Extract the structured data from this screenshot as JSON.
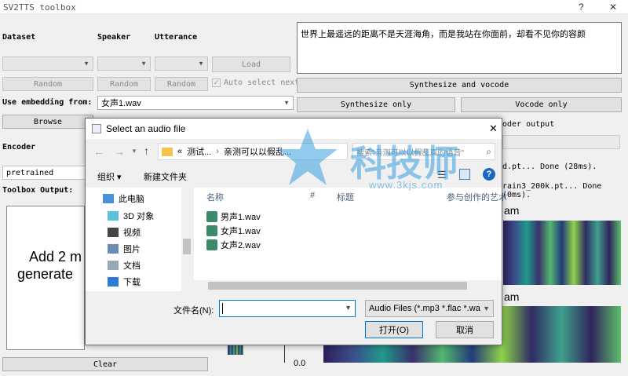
{
  "window": {
    "title": "SV2TTS toolbox",
    "help": "?",
    "close": "✕"
  },
  "main": {
    "dataset_label": "Dataset",
    "speaker_label": "Speaker",
    "utterance_label": "Utterance",
    "load_button": "Load",
    "random1": "Random",
    "random2": "Random",
    "random3": "Random",
    "auto_select": "Auto select next",
    "use_embedding_label": "Use embedding from:",
    "embedding_value": "女声1.wav",
    "browse_button": "Browse",
    "encoder_label": "Encoder",
    "encoder_value": "pretrained",
    "toolbox_output_label": "Toolbox Output:",
    "placeholder_text_1": "Add 2 m",
    "placeholder_text_2": "generate",
    "clear_button": "Clear",
    "text_input": "世界上最遥远的距离不是天涯海角，而是我站在你面前，却看不见你的容颜",
    "synth_vocode_button": "Synthesize and vocode",
    "synth_only_button": "Synthesize only",
    "vocode_only_button": "Vocode only",
    "encoder_output_label": "oder output",
    "log_line1": "d.pt... Done (28ms).",
    "log_line2": "rain3_200k.pt... Done (0ms).",
    "spec_title1": "am",
    "spec_title2": "am",
    "axis_value": "0.0"
  },
  "dialog": {
    "title": "Select an audio file",
    "close": "✕",
    "path_prefix": "«",
    "path_seg1": "测试...",
    "path_seg2": "亲测可以以假乱...",
    "search_placeholder": "搜索\"亲测可以以假乱真的语音\"",
    "organize": "组织 ▾",
    "new_folder": "新建文件夹",
    "tree": [
      "此电脑",
      "3D 对象",
      "视频",
      "图片",
      "文档",
      "下载"
    ],
    "columns": {
      "name": "名称",
      "number": "#",
      "title": "标题",
      "artist": "参与创作的艺术"
    },
    "files": [
      "男声1.wav",
      "女声1.wav",
      "女声2.wav"
    ],
    "filename_label": "文件名(N):",
    "filename_value": "",
    "filter_value": "Audio Files (*.mp3 *.flac *.wa",
    "open_button": "打开(O)",
    "cancel_button": "取消"
  },
  "watermark": {
    "text": "科技师",
    "url": "www.3kjs.com"
  }
}
